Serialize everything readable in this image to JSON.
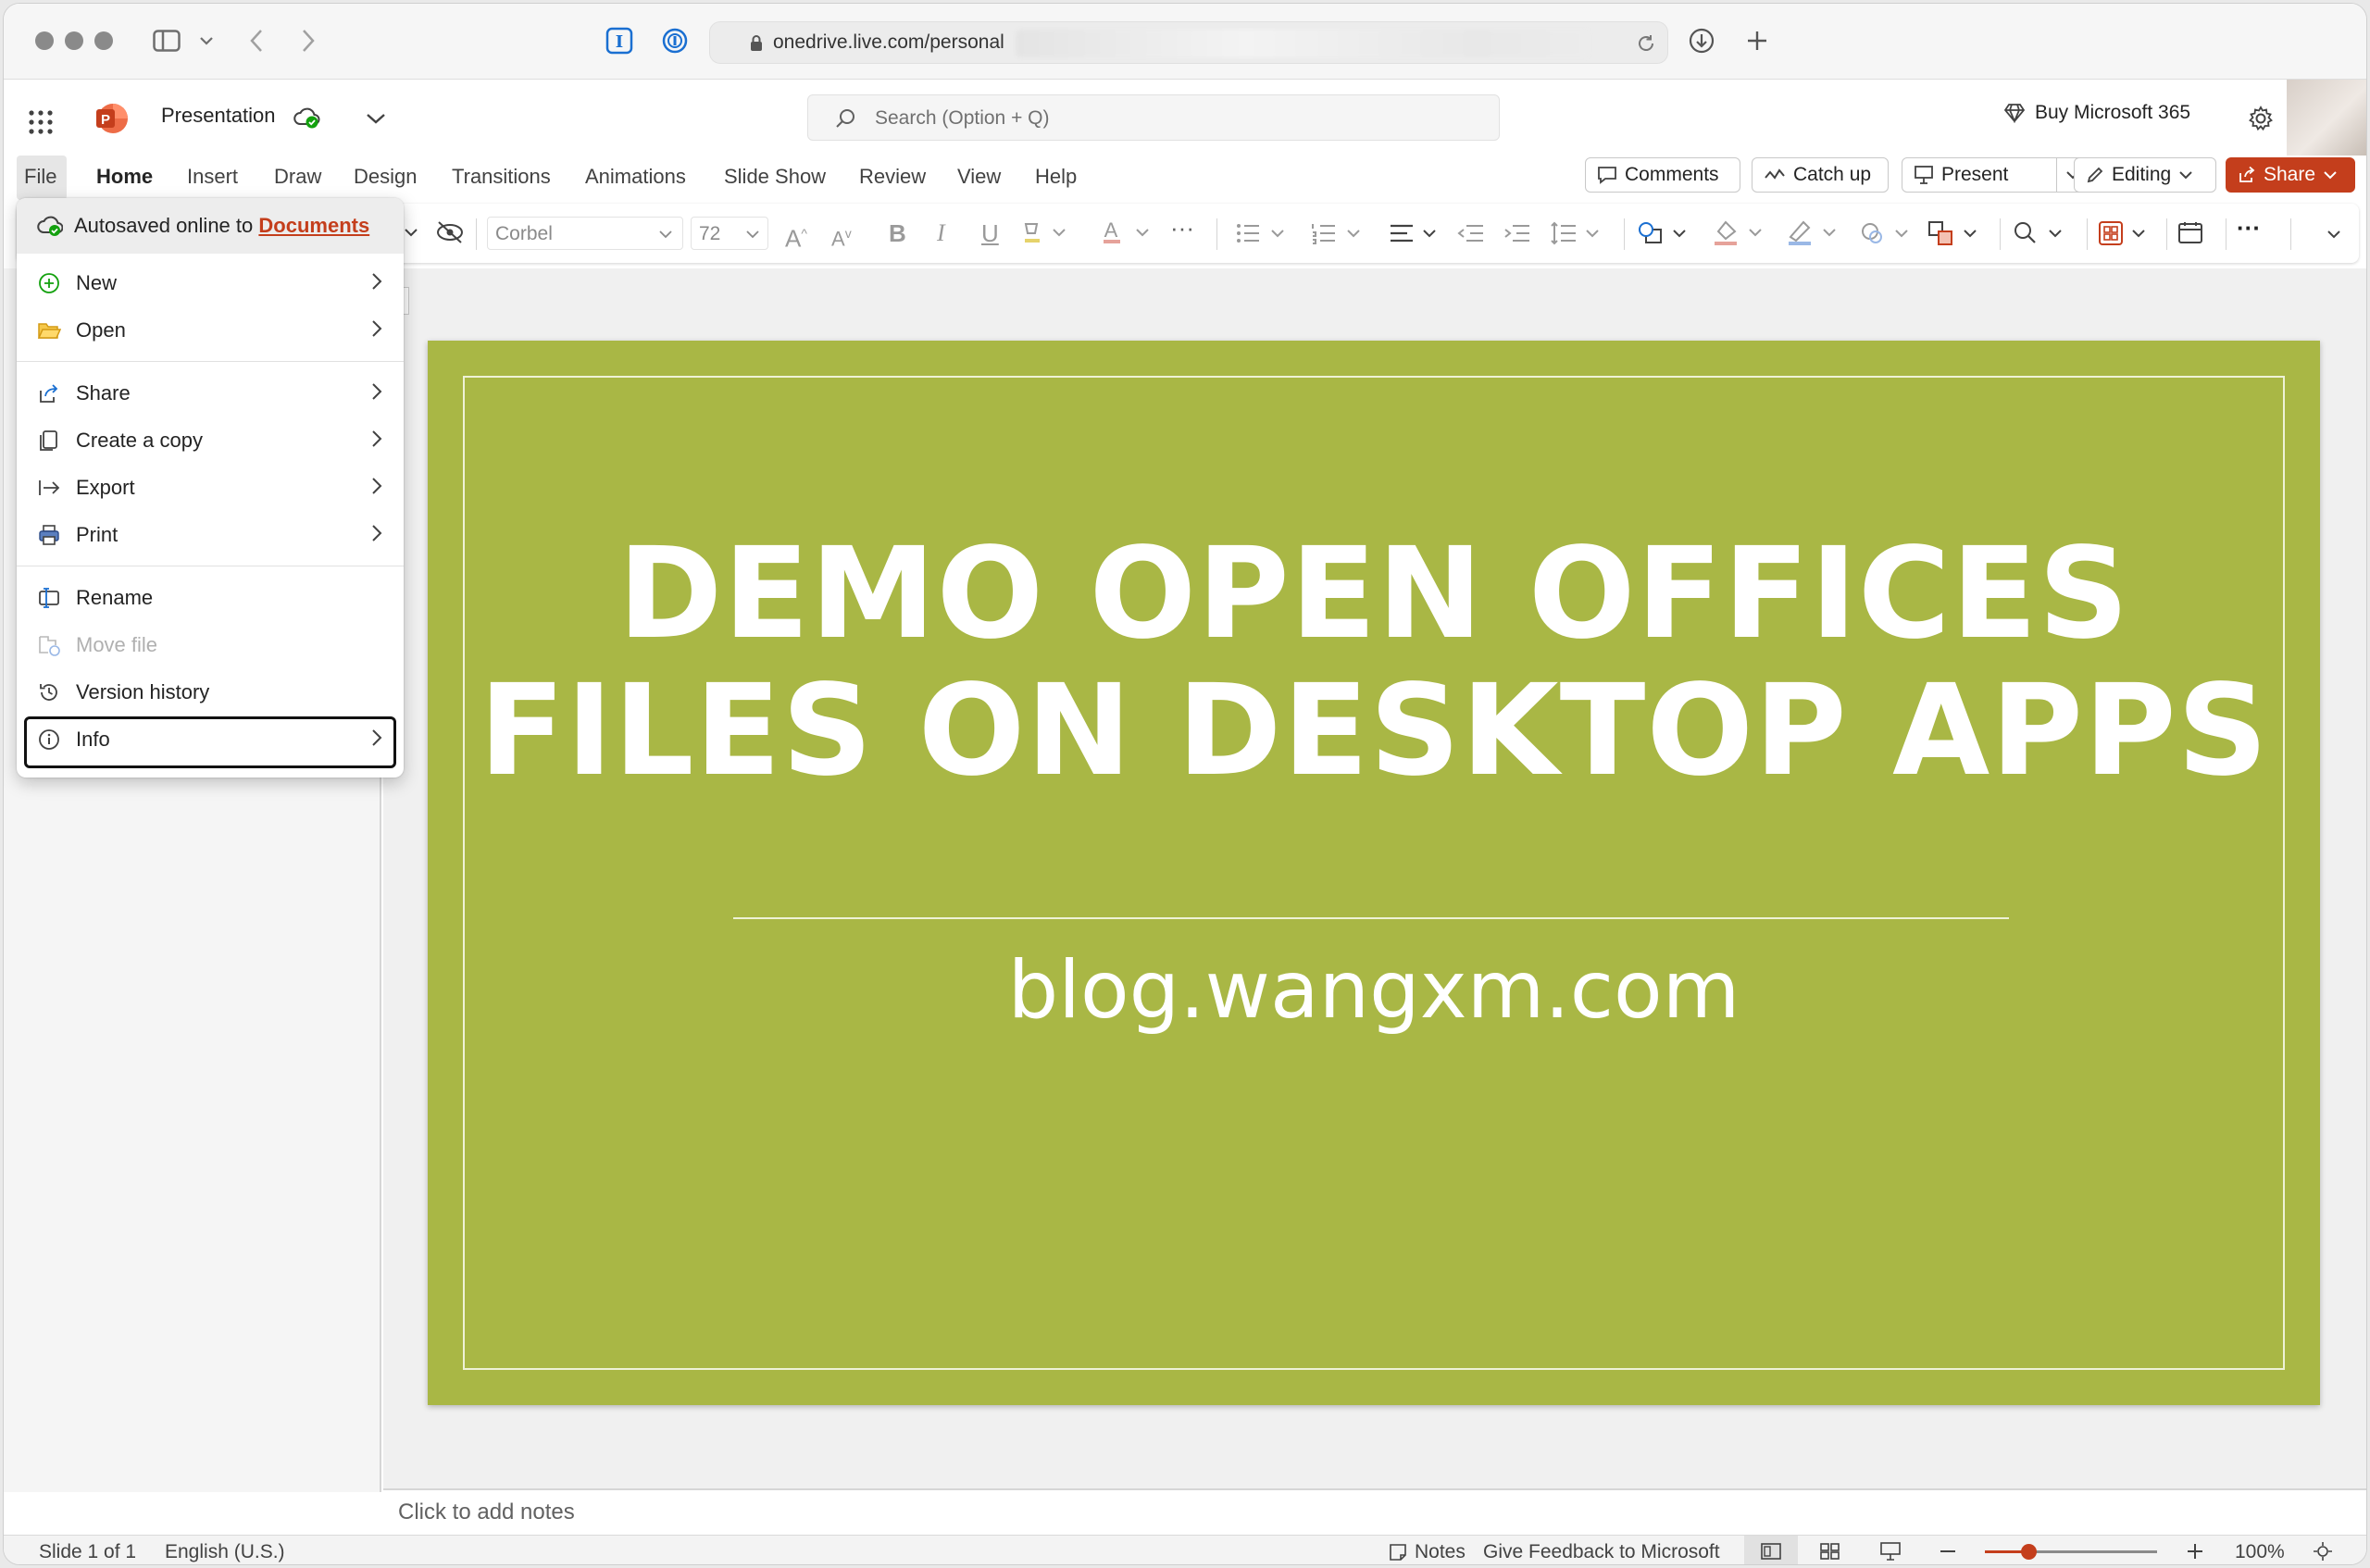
{
  "browser": {
    "url": "onedrive.live.com/personal"
  },
  "app": {
    "title": "Presentation",
    "search_placeholder": "Search (Option + Q)",
    "buy": "Buy Microsoft 365"
  },
  "tabs": [
    "File",
    "Home",
    "Insert",
    "Draw",
    "Design",
    "Transitions",
    "Animations",
    "Slide Show",
    "Review",
    "View",
    "Help"
  ],
  "actions": {
    "comments": "Comments",
    "catch_up": "Catch up",
    "present": "Present",
    "editing": "Editing",
    "share": "Share"
  },
  "ribbon": {
    "font": "Corbel",
    "size": "72"
  },
  "file_menu": {
    "autosave_prefix": "Autosaved online to",
    "autosave_link": "Documents",
    "items": [
      "New",
      "Open",
      "Share",
      "Create a copy",
      "Export",
      "Print",
      "Rename",
      "Move file",
      "Version history",
      "Info"
    ]
  },
  "slide": {
    "title_line1": "DEMO OPEN OFFICES",
    "title_line2": "FILES ON DESKTOP APPS",
    "subtitle": "blog.wangxm.com"
  },
  "notes_placeholder": "Click to add notes",
  "status": {
    "slide_info": "Slide 1 of 1",
    "language": "English (U.S.)",
    "notes": "Notes",
    "feedback": "Give Feedback to Microsoft",
    "zoom": "100%",
    "zoom_level": 0.25
  },
  "colors": {
    "accent": "#c43e1c",
    "slide_bg": "#a9b745"
  }
}
